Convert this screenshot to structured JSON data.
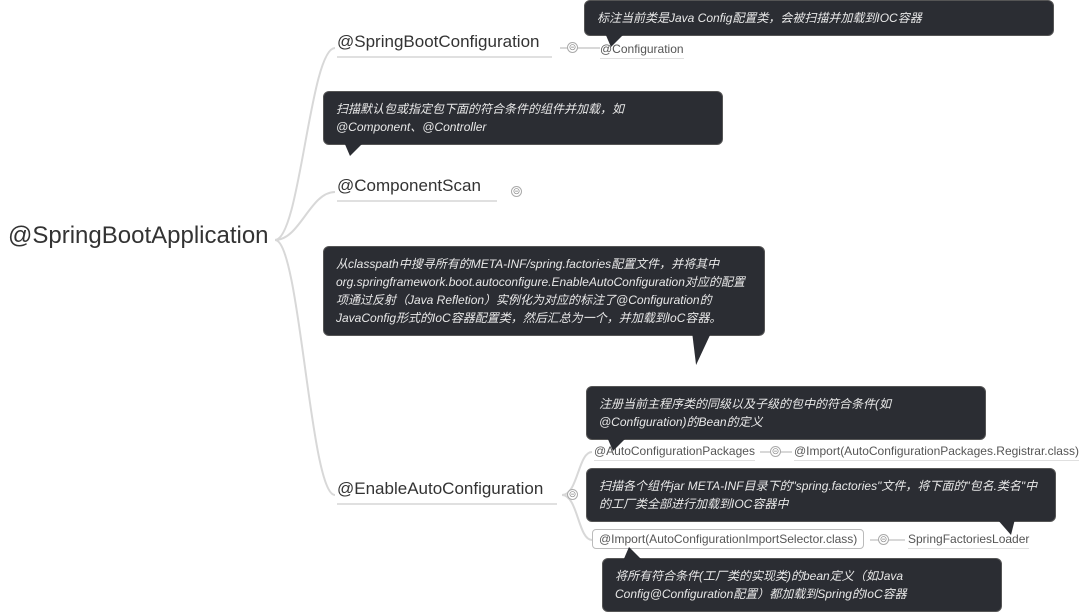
{
  "root": {
    "label": "@SpringBootApplication"
  },
  "branches": {
    "config": {
      "label": "@SpringBootConfiguration",
      "child": {
        "label": "@Configuration",
        "tooltip": "标注当前类是Java Config配置类，会被扫描并加载到IOC容器"
      }
    },
    "scan": {
      "label": "@ComponentScan",
      "tooltip": "扫描默认包或指定包下面的符合条件的组件并加载，如@Component、@Controller"
    },
    "enable": {
      "label": "@EnableAutoConfiguration",
      "tooltip": "从classpath中搜寻所有的META-INF/spring.factories配置文件，并将其中\norg.springframework.boot.autoconfigure.EnableAutoConfiguration对应的配置项通过反射（Java Refletion）实例化为对应的标注了@Configuration的JavaConfig形式的IoC容器配置类，然后汇总为一个，并加载到IoC容器。",
      "children": {
        "pkg": {
          "label": "@AutoConfigurationPackages",
          "child_label": "@Import(AutoConfigurationPackages.Registrar.class)",
          "tooltip": "注册当前主程序类的同级以及子级的包中的符合条件(如@Configuration)的Bean的定义"
        },
        "imp": {
          "label": "@Import(AutoConfigurationImportSelector.class)",
          "child_label": "SpringFactoriesLoader",
          "tooltip": "扫描各个组件jar META-INF目录下的\"spring.factories\"文件，将下面的\"包名.类名\"中的工厂类全部进行加载到IOC容器中",
          "child_tooltip": "将所有符合条件(工厂类的实现类)的bean定义（如Java Config@Configuration配置）都加载到Spring的IoC容器"
        }
      }
    }
  },
  "collapse_glyph": "⊝"
}
